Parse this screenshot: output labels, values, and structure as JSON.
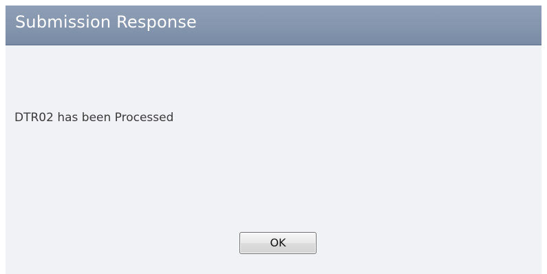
{
  "dialog": {
    "title": "Submission Response",
    "message": "DTR02 has been Processed",
    "ok_label": "OK"
  },
  "colors": {
    "header_bg": "#8596ae",
    "body_bg": "#f1f2f6",
    "title_text": "#ffffff",
    "message_text": "#3a3a3a"
  }
}
